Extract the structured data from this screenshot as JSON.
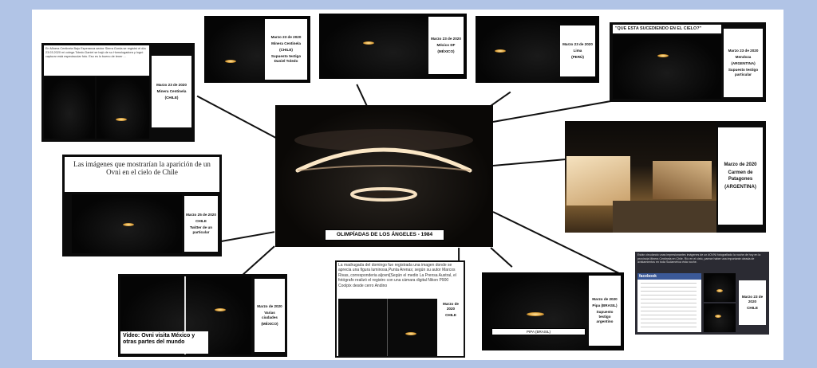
{
  "center": {
    "caption": "OLIMPÍADAS DE LOS ÁNGELES - 1984"
  },
  "p1": {
    "snippet": "En Minera Centinela Bajo Esperanza sector Sierra Gorda se registró el día 23.03.2020 mi colega Toledo Daniel se bajó de su Homologadora y logró capturar está espectacular foto. Eso es lo bueno de tener ...",
    "date": "Marzo 23 de 2020",
    "place": "Minera Centinela",
    "country": "(CHILE)"
  },
  "p2": {
    "date": "Marzo 23 de 2020",
    "place": "Minera Centinela",
    "country": "(CHILE)",
    "witness": "Supuesto testigo Daniel Toledo"
  },
  "p3": {
    "date": "Marzo 23 de 2020",
    "place": "México DF",
    "country": "(MÉXICO)"
  },
  "p4": {
    "date": "Marzo 23 de 2020",
    "place": "Lima",
    "country": "(PERÚ)"
  },
  "p5": {
    "quote": "\"QUE ESTA SUCEDIENDO EN EL CIELO?\"",
    "date": "Marzo 23 de 2020",
    "place": "Mendoza",
    "country": "(ARGENTINA)",
    "witness": "Supuesto testigo particular"
  },
  "p6": {
    "date": "Marzo de 2020",
    "place": "Carmen de Patagones",
    "country": "(ARGENTINA)"
  },
  "p7": {
    "headline": "Las imágenes que mostrarían la aparición de un Ovni en el cielo de Chile",
    "date": "Marzo 25 de 2020",
    "country": "CHILE",
    "source": "Twitter de un particular"
  },
  "p8": {
    "caption": "Video: Ovni visita México y otras partes del mundo",
    "date": "Marzo de 2020",
    "place": "Varias ciudades",
    "country": "(MÉXICO)"
  },
  "p9": {
    "text": "La madrugada del domingo fue registrada una imagen donde se aprecia una figura luminosa,Punta Arenas; según su autor Marcos Rivas, corresponderia aljovni[Según el medio La Prensa Austral, el fotógrafo realizó el registro con una cámara digital Nikon P900 Coolpix desde cerro Andino",
    "date": "Marzo de 2020",
    "country": "CHILE"
  },
  "p10": {
    "label": "PIPA (BRASIL)",
    "date": "Marzo de 2020",
    "place": "Pipa (BRASIL)",
    "witness": "Supuesto testigo argentino"
  },
  "p11": {
    "text": "Están circulando unas impresionantes imágenes de un #OVNI fotografiado la noche de hoy en la provincia Minera Centinela en Chile. Río en el cielo, parece haber una importante oleada de avistamientos en toda Sudamérica ésta noche.",
    "fb": "facebook",
    "date": "Marzo 23 de 2020",
    "country": "CHILE"
  }
}
